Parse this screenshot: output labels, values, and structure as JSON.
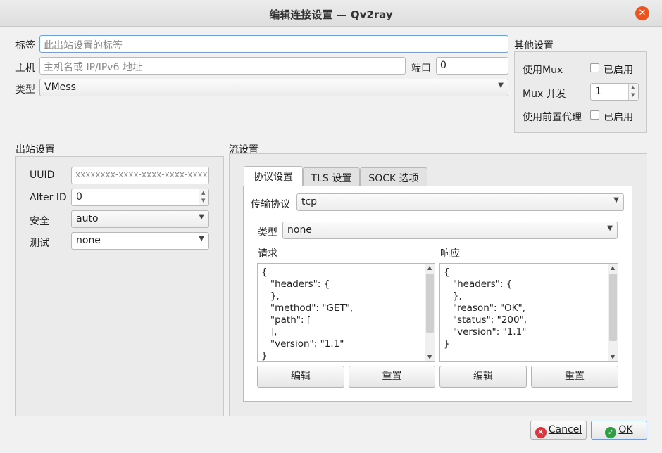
{
  "window": {
    "title": "编辑连接设置 — Qv2ray"
  },
  "main": {
    "tag_label": "标签",
    "tag_placeholder": "此出站设置的标签",
    "host_label": "主机",
    "host_placeholder": "主机名或 IP/IPv6 地址",
    "port_label": "端口",
    "port_value": "0",
    "type_label": "类型",
    "type_value": "VMess"
  },
  "other": {
    "title": "其他设置",
    "mux_label": "使用Mux",
    "mux_enabled_label": "已启用",
    "mux_concurrency_label": "Mux 并发",
    "mux_concurrency_value": "1",
    "proxy_label": "使用前置代理",
    "proxy_enabled_label": "已启用"
  },
  "outbound": {
    "title": "出站设置",
    "uuid_label": "UUID",
    "uuid_placeholder": "xxxxxxxx-xxxx-xxxx-xxxx-xxxxxxxxxxxx",
    "alterid_label": "Alter ID",
    "alterid_value": "0",
    "security_label": "安全",
    "security_value": "auto",
    "test_label": "测试",
    "test_value": "none"
  },
  "stream": {
    "title": "流设置",
    "tabs": [
      "协议设置",
      "TLS 设置",
      "SOCK 选项"
    ],
    "transport_label": "传输协议",
    "transport_value": "tcp",
    "type_label": "类型",
    "type_value": "none",
    "request_label": "请求",
    "request_text": "{\n   \"headers\": {\n   },\n   \"method\": \"GET\",\n   \"path\": [\n   ],\n   \"version\": \"1.1\"\n}",
    "response_label": "响应",
    "response_text": "{\n   \"headers\": {\n   },\n   \"reason\": \"OK\",\n   \"status\": \"200\",\n   \"version\": \"1.1\"\n}",
    "edit_label": "编辑",
    "reset_label": "重置"
  },
  "footer": {
    "cancel_label": "Cancel",
    "ok_label": "OK"
  },
  "colors": {
    "accent": "#e95420",
    "cancel_icon": "#d9363e",
    "ok_icon": "#2f9e44"
  }
}
